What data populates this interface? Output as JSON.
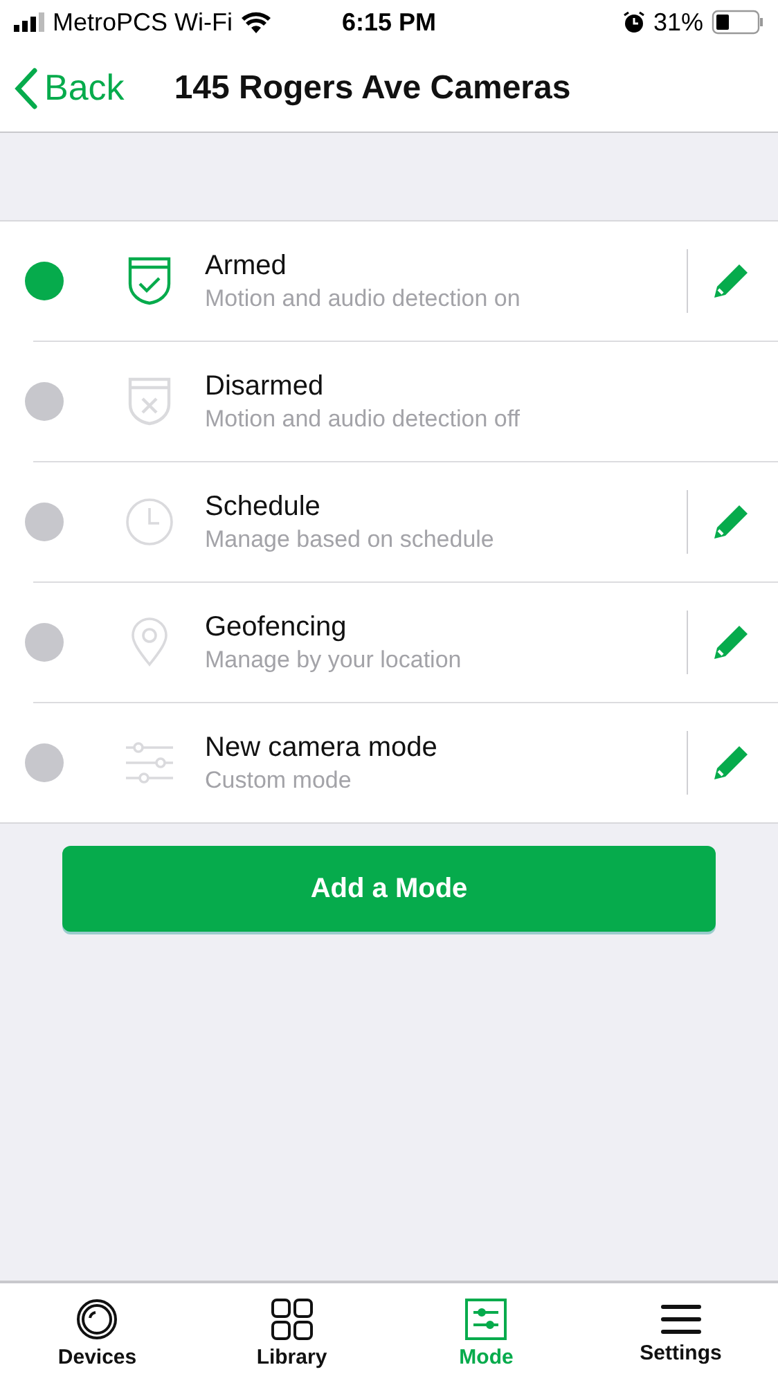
{
  "status_bar": {
    "carrier": "MetroPCS Wi-Fi",
    "time": "6:15 PM",
    "battery": "31%"
  },
  "nav": {
    "back": "Back",
    "title": "145 Rogers Ave Cameras"
  },
  "modes": [
    {
      "kind": "armed",
      "name": "Armed",
      "description": "Motion and audio detection on",
      "selected": true,
      "editable": true
    },
    {
      "kind": "disarmed",
      "name": "Disarmed",
      "description": "Motion and audio detection off",
      "selected": false,
      "editable": false
    },
    {
      "kind": "schedule",
      "name": "Schedule",
      "description": "Manage based on schedule",
      "selected": false,
      "editable": true
    },
    {
      "kind": "geofencing",
      "name": "Geofencing",
      "description": "Manage by your location",
      "selected": false,
      "editable": true
    },
    {
      "kind": "custom",
      "name": "New camera mode",
      "description": "Custom mode",
      "selected": false,
      "editable": true
    }
  ],
  "add_button": "Add a Mode",
  "tabs": [
    {
      "kind": "devices",
      "label": "Devices",
      "selected": false
    },
    {
      "kind": "library",
      "label": "Library",
      "selected": false
    },
    {
      "kind": "mode",
      "label": "Mode",
      "selected": true
    },
    {
      "kind": "settings",
      "label": "Settings",
      "selected": false
    }
  ]
}
